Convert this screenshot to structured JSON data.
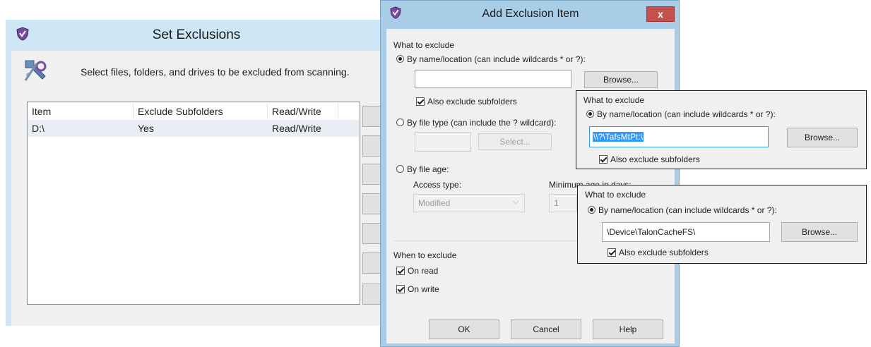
{
  "set_exclusions": {
    "title": "Set Exclusions",
    "description": "Select files, folders, and drives to be excluded from scanning.",
    "columns": [
      "Item",
      "Exclude Subfolders",
      "Read/Write"
    ],
    "rows": [
      {
        "item": "D:\\",
        "subfolders": "Yes",
        "rw": "Read/Write"
      }
    ]
  },
  "dialog": {
    "title": "Add Exclusion Item",
    "close_label": "x",
    "what_group": "What to exclude",
    "by_name_label": "By name/location (can include wildcards * or ?):",
    "name_value": "",
    "browse_label": "Browse...",
    "also_subfolders": "Also exclude subfolders",
    "by_type_label": "By file type (can include the ? wildcard):",
    "select_label": "Select...",
    "by_age_label": "By file age:",
    "access_type_label": "Access type:",
    "access_type_value": "Modified",
    "min_age_label": "Minimum age in days:",
    "min_age_value": "1",
    "when_group": "When to exclude",
    "on_read": "On read",
    "on_write": "On write",
    "ok_label": "OK",
    "cancel_label": "Cancel",
    "help_label": "Help"
  },
  "callout1": {
    "group": "What to exclude",
    "by_name_label": "By name/location (can include wildcards * or ?):",
    "value": "\\\\?\\TafsMtPt:\\",
    "browse_label": "Browse...",
    "also_subfolders": "Also exclude subfolders"
  },
  "callout2": {
    "group": "What to exclude",
    "by_name_label": "By name/location (can include wildcards * or ?):",
    "value": "\\Device\\TalonCacheFS\\",
    "browse_label": "Browse...",
    "also_subfolders": "Also exclude subfolders"
  },
  "icons": {
    "app_icon": "shield-icon",
    "header_icon": "settings-tools-icon",
    "dialog_icon": "shield-icon"
  },
  "colors": {
    "window_frame": "#cfe6f4",
    "dialog_frame": "#a9cde7",
    "close_button": "#c75050",
    "selection": "#3399ff"
  }
}
